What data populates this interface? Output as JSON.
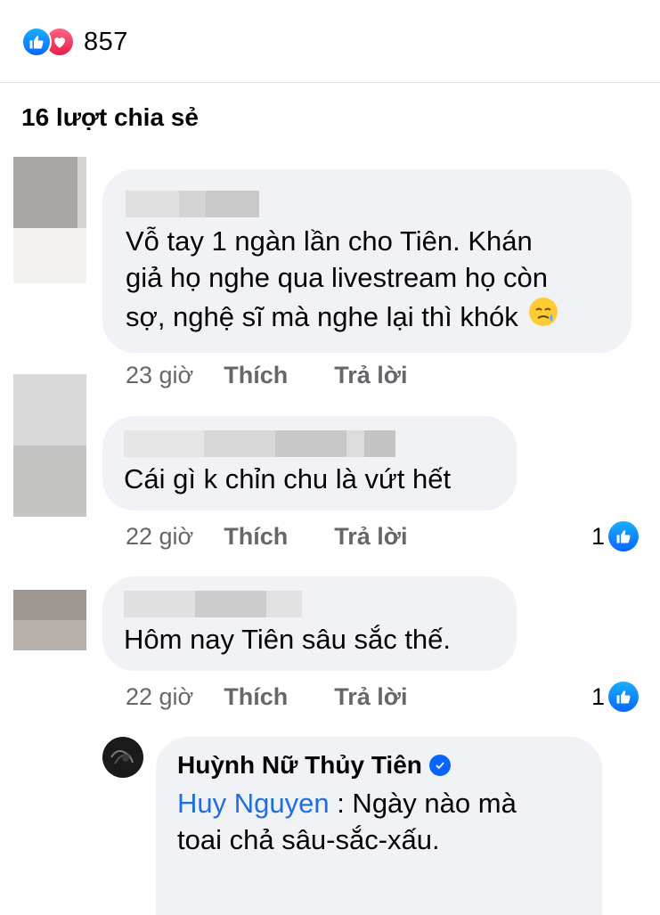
{
  "reactions": {
    "count": "857",
    "icons": [
      "like-icon",
      "love-icon"
    ],
    "like_color": "#0866ff",
    "love_color": "#e61e4d"
  },
  "shares": {
    "label": "16 lượt chia sẻ"
  },
  "comments": [
    {
      "text_lines": [
        "Vỗ tay 1 ngàn lần cho Tiên. Khán",
        "giả họ nghe qua livestream họ còn",
        "sợ, nghệ sĩ mà nghe lại thì khók"
      ],
      "emoji": "face-holding-back-tears",
      "time": "23 giờ",
      "like_label": "Thích",
      "reply_label": "Trả lời"
    },
    {
      "text_lines": [
        "Cái gì k chỉn chu là vứt hết"
      ],
      "time": "22 giờ",
      "like_label": "Thích",
      "reply_label": "Trả lời",
      "likes": "1"
    },
    {
      "text_lines": [
        "Hôm nay Tiên sâu sắc thế."
      ],
      "time": "22 giờ",
      "like_label": "Thích",
      "reply_label": "Trả lời",
      "likes": "1"
    }
  ],
  "reply": {
    "author": "Huỳnh Nữ Thủy Tiên",
    "verified": true,
    "mention": "Huy Nguyen",
    "text_line1": " : Ngày nào mà",
    "text_line2": "toai chả sâu-sắc-xấu."
  }
}
